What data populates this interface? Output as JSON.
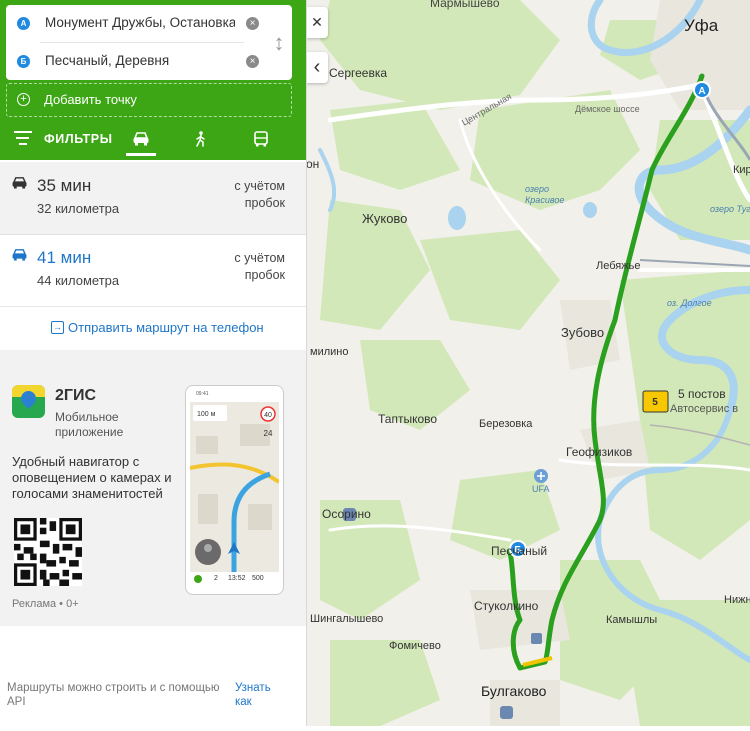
{
  "route_inputs": {
    "point_a": {
      "badge": "А",
      "value": "Монумент Дружбы, Остановка на"
    },
    "point_b": {
      "badge": "Б",
      "value": "Песчаный, Деревня"
    },
    "add_point_label": "Добавить точку"
  },
  "filters": {
    "label": "ФИЛЬТРЫ",
    "modes": [
      {
        "name": "car",
        "icon": "car-icon",
        "active": true
      },
      {
        "name": "walk",
        "icon": "pedestrian-icon",
        "active": false
      },
      {
        "name": "bus",
        "icon": "bus-icon",
        "active": false
      }
    ]
  },
  "route_options": [
    {
      "time": "35 мин",
      "distance": "32 километра",
      "traffic_note": "с учётом пробок",
      "icon": "car-icon"
    },
    {
      "time": "41 мин",
      "distance": "44 километра",
      "traffic_note": "с учётом пробок",
      "icon": "car-icon"
    }
  ],
  "send_to_phone": {
    "icon": "send-icon",
    "label": "Отправить маршрут на телефон"
  },
  "ad": {
    "title": "2ГИС",
    "subtitle": "Мобильное приложение",
    "description": "Удобный навигатор с оповещением о камерах и голосами знаменитостей",
    "footer": "Реклама • 0+",
    "phone_screen": {
      "distance": "100 м",
      "speed_limit": "40",
      "speed": "24",
      "bottom_bar": [
        "2",
        "13:52",
        "500"
      ]
    }
  },
  "api_note": "Маршруты можно строить и с помощью API",
  "api_link": "Узнать как",
  "map_controls": {
    "close": "✕",
    "collapse": "‹"
  },
  "map_labels": [
    "Мармышево",
    "Уфа",
    "Сергеевка",
    "Центральная",
    "Дёмское шоссе",
    "Кирз",
    "озеро Тугва",
    "Лебяжье",
    "озеро Красивое",
    "Жуково",
    "Зубово",
    "оз. Долгое",
    "Таптыково",
    "Березовка",
    "Геофизиков",
    "5 постов",
    "Автосервис в",
    "UFA",
    "Осорино",
    "Песчаный",
    "Стуколкино",
    "Шингалышево",
    "Фомичево",
    "Камышлы",
    "Булгаково",
    "Нижн",
    "он",
    "милино"
  ],
  "colors": {
    "brand_green": "#3ca614",
    "route_green": "#2aa01e",
    "link_blue": "#1f76c8",
    "water": "#a9d3ee",
    "forest": "#cfe6b4"
  }
}
